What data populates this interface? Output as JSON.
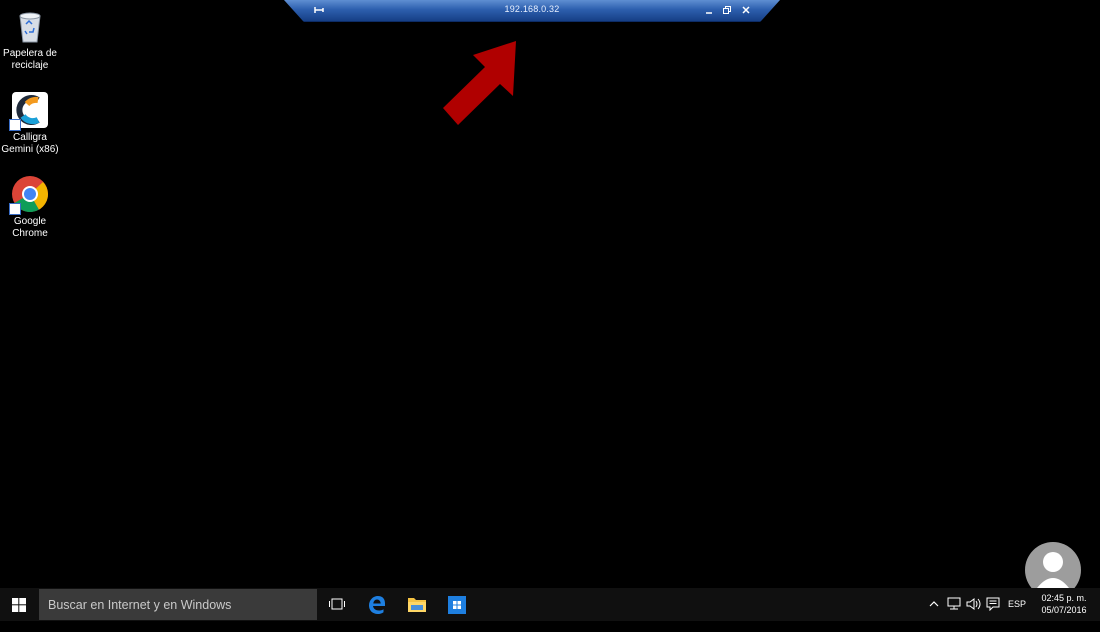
{
  "remote_bar": {
    "title": "192.168.0.32",
    "pin_icon": "pin-icon",
    "minimize_icon": "minimize-icon",
    "restore_icon": "restore-icon",
    "close_icon": "close-icon"
  },
  "annotation": {
    "arrow_color": "#b00000"
  },
  "desktop": {
    "icons": [
      {
        "label_line1": "Papelera de",
        "label_line2": "reciclaje",
        "icon": "recycle-bin-icon"
      },
      {
        "label_line1": "Calligra",
        "label_line2": "Gemini (x86)",
        "icon": "calligra-gemini-icon"
      },
      {
        "label_line1": "Google",
        "label_line2": "Chrome",
        "icon": "google-chrome-icon"
      }
    ]
  },
  "taskbar": {
    "search_placeholder": "Buscar en Internet y en Windows",
    "language": "ESP",
    "time": "02:45 p. m.",
    "date": "05/07/2016"
  },
  "colors": {
    "desktop_bg": "#000000",
    "taskbar_bg": "#101010",
    "connection_bar": "#2d5fae"
  }
}
